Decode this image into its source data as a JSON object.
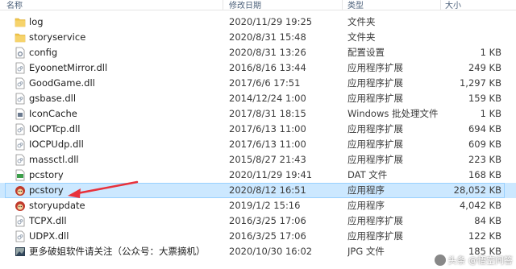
{
  "columns": {
    "name": "名称",
    "date": "修改日期",
    "type": "类型",
    "size": "大小"
  },
  "files": [
    {
      "name": "log",
      "date": "2020/11/29 19:25",
      "type": "文件夹",
      "size": "",
      "icon": "folder-icon"
    },
    {
      "name": "storyservice",
      "date": "2020/8/31 15:48",
      "type": "文件夹",
      "size": "",
      "icon": "folder-icon"
    },
    {
      "name": "config",
      "date": "2020/8/31 13:26",
      "type": "配置设置",
      "size": "1 KB",
      "icon": "config-file-icon"
    },
    {
      "name": "EyoonetMirror.dll",
      "date": "2016/8/16 13:44",
      "type": "应用程序扩展",
      "size": "249 KB",
      "icon": "dll-file-icon"
    },
    {
      "name": "GoodGame.dll",
      "date": "2017/6/6 17:51",
      "type": "应用程序扩展",
      "size": "1,297 KB",
      "icon": "dll-file-icon"
    },
    {
      "name": "gsbase.dll",
      "date": "2014/12/24 1:00",
      "type": "应用程序扩展",
      "size": "159 KB",
      "icon": "dll-file-icon"
    },
    {
      "name": "IconCache",
      "date": "2017/8/31 18:15",
      "type": "Windows 批处理文件",
      "size": "1 KB",
      "icon": "batch-file-icon"
    },
    {
      "name": "IOCPTcp.dll",
      "date": "2017/6/13 11:00",
      "type": "应用程序扩展",
      "size": "694 KB",
      "icon": "dll-file-icon"
    },
    {
      "name": "IOCPUdp.dll",
      "date": "2017/6/13 11:00",
      "type": "应用程序扩展",
      "size": "609 KB",
      "icon": "dll-file-icon"
    },
    {
      "name": "massctl.dll",
      "date": "2015/8/27 21:43",
      "type": "应用程序扩展",
      "size": "223 KB",
      "icon": "dll-file-icon"
    },
    {
      "name": "pcstory",
      "date": "2020/11/29 19:41",
      "type": "DAT 文件",
      "size": "168 KB",
      "icon": "dat-file-icon"
    },
    {
      "name": "pcstory",
      "date": "2020/8/12 16:51",
      "type": "应用程序",
      "size": "28,052 KB",
      "icon": "app-icon",
      "selected": true
    },
    {
      "name": "storyupdate",
      "date": "2019/1/2 15:16",
      "type": "应用程序",
      "size": "4,042 KB",
      "icon": "app-icon"
    },
    {
      "name": "TCPX.dll",
      "date": "2016/3/25 17:06",
      "type": "应用程序扩展",
      "size": "84 KB",
      "icon": "dll-file-icon"
    },
    {
      "name": "UDPX.dll",
      "date": "2016/3/25 17:06",
      "type": "应用程序扩展",
      "size": "122 KB",
      "icon": "dll-file-icon"
    },
    {
      "name": "更多破姐软件请关注（公众号：大票摘机）",
      "date": "2020/10/30 16:02",
      "type": "JPG 文件",
      "size": "185 KB",
      "icon": "jpg-file-icon"
    }
  ],
  "watermark": "头条 @悟空问答",
  "colors": {
    "selected_bg": "#cce8ff",
    "selected_border": "#99d1ff",
    "arrow": "#e8323c",
    "folder": "#f0c64a"
  }
}
